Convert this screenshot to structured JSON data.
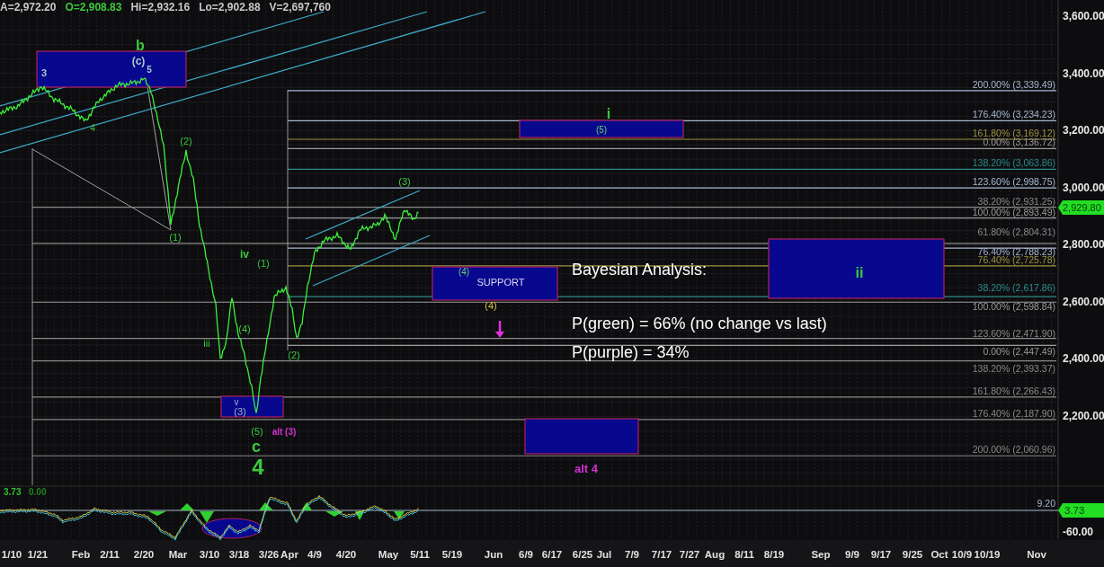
{
  "quote_header": [
    {
      "text": "A=2,972.20",
      "color": "#c8c8c8"
    },
    {
      "text": "O=2,908.83",
      "color": "#3cc83c"
    },
    {
      "text": "Hi=2,932.16",
      "color": "#c8c8c8"
    },
    {
      "text": "Lo=2,902.88",
      "color": "#c8c8c8"
    },
    {
      "text": "V=2,697,760",
      "color": "#c8c8c8"
    }
  ],
  "price_axis": [
    "3,600.00",
    "3,400.00",
    "3,200.00",
    "3,000.00",
    "2,800.00",
    "2,600.00",
    "2,400.00",
    "2,200.00"
  ],
  "last_price": "2,929.80",
  "fib_levels": [
    {
      "label": "200.00% (3,339.49)",
      "color": "#a8b8d0"
    },
    {
      "label": "176.40% (3,234.23)",
      "color": "#a8b8d0"
    },
    {
      "label": "161.80% (3,169.12)",
      "color": "#9c9440"
    },
    {
      "label": "0.00% (3,136.72)",
      "color": "#9a9a9a"
    },
    {
      "label": "138.20% (3,063.86)",
      "color": "#2e8a8a"
    },
    {
      "label": "123.60% (2,998.75)",
      "color": "#a8b8d0"
    },
    {
      "label": "38.20% (2,931.25)",
      "color": "#8a8a8a"
    },
    {
      "label": "100.00% (2,893.49)",
      "color": "#9a9a9a"
    },
    {
      "label": "61.80% (2,804.31)",
      "color": "#8a8a8a"
    },
    {
      "label": "76.40% (2,788.23)",
      "color": "#a8b8d0"
    },
    {
      "label": "76.40% (2,725.78)",
      "color": "#9c9440"
    },
    {
      "label": "38.20% (2,617.86)",
      "color": "#2e8a8a"
    },
    {
      "label": "100.00% (2,598.84)",
      "color": "#9a9a9a"
    },
    {
      "label": "123.60% (2,471.90)",
      "color": "#8a8a8a"
    },
    {
      "label": "0.00% (2,447.49)",
      "color": "#9a9a9a"
    },
    {
      "label": "138.20% (2,393.37)",
      "color": "#8a8a8a"
    },
    {
      "label": "161.80% (2,266.43)",
      "color": "#8a8a8a"
    },
    {
      "label": "176.40% (2,187.90)",
      "color": "#8a8a8a"
    },
    {
      "label": "200.00% (2,060.96)",
      "color": "#8a8a8a"
    }
  ],
  "zones": [
    {
      "kind": "box"
    },
    {
      "kind": "box",
      "labels": [
        "(5)"
      ]
    },
    {
      "kind": "box",
      "labels": [
        "(4)",
        "SUPPORT"
      ]
    },
    {
      "kind": "box",
      "labels": [
        "ii"
      ]
    },
    {
      "kind": "box",
      "labels": [
        "v",
        "(3)"
      ]
    },
    {
      "kind": "box"
    }
  ],
  "wave_labels": [
    {
      "text": "b",
      "color": "#3cc83c"
    },
    {
      "text": "(c)",
      "color": "#a8c8c8"
    },
    {
      "text": "5",
      "color": "#a8c8c8"
    },
    {
      "text": "3",
      "color": "#a8c8c8"
    },
    {
      "text": "4",
      "color": "#3cc83c"
    },
    {
      "text": "(2)",
      "color": "#3cc83c"
    },
    {
      "text": "(1)",
      "color": "#3cc83c"
    },
    {
      "text": "iv",
      "color": "#3cc83c"
    },
    {
      "text": "(1)",
      "color": "#3cc83c"
    },
    {
      "text": "(4)",
      "color": "#3cc83c"
    },
    {
      "text": "iii",
      "color": "#3cc83c"
    },
    {
      "text": "(2)",
      "color": "#3cc83c"
    },
    {
      "text": "(5)",
      "color": "#3cc83c"
    },
    {
      "text": "alt (3)",
      "color": "#d030d0"
    },
    {
      "text": "c",
      "color": "#3cc83c"
    },
    {
      "text": "4",
      "color": "#3cc83c"
    },
    {
      "text": "(3)",
      "color": "#3cc83c"
    },
    {
      "text": "i",
      "color": "#3cc83c"
    },
    {
      "text": "(4)",
      "color": "#d8c040"
    },
    {
      "text": "alt 4",
      "color": "#d030d0"
    }
  ],
  "analysis": {
    "title": "Bayesian Analysis:",
    "lines": [
      "P(green) = 66% (no change vs last)",
      "P(purple) = 34%"
    ]
  },
  "indicator": {
    "header": [
      "3.73",
      "0.00"
    ],
    "level_label": "9.20",
    "last_value": "3.73",
    "axis": [
      "-60.00"
    ]
  },
  "time_axis": [
    "1/10",
    "1/21",
    "Feb",
    "2/11",
    "2/20",
    "Mar",
    "3/10",
    "3/18",
    "3/26",
    "Apr",
    "4/9",
    "4/20",
    "May",
    "5/11",
    "5/19",
    "Jun",
    "6/9",
    "6/17",
    "6/25",
    "Jul",
    "7/9",
    "7/17",
    "7/27",
    "Aug",
    "8/11",
    "8/19",
    "Sep",
    "9/9",
    "9/17",
    "9/25",
    "Oct",
    "10/9",
    "10/19",
    "Nov"
  ]
}
